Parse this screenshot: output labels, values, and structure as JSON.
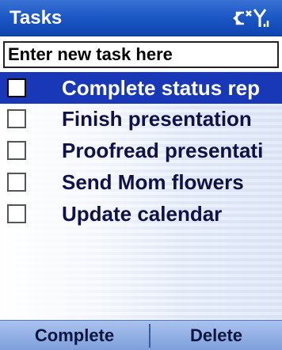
{
  "titlebar": {
    "title": "Tasks",
    "icons": [
      "connectivity-icon",
      "signal-strength-icon"
    ]
  },
  "new_task": {
    "placeholder": "Enter new task here"
  },
  "tasks": [
    {
      "label": "Complete status rep",
      "checked": false,
      "selected": true
    },
    {
      "label": "Finish presentation",
      "checked": false,
      "selected": false
    },
    {
      "label": "Proofread presentati",
      "checked": false,
      "selected": false
    },
    {
      "label": "Send Mom flowers",
      "checked": false,
      "selected": false
    },
    {
      "label": "Update calendar",
      "checked": false,
      "selected": false
    }
  ],
  "softkeys": {
    "left": "Complete",
    "right": "Delete"
  },
  "colors": {
    "titlebar": "#1a56c4",
    "selection": "#1838b8",
    "softkey_bar": "#8fb0e6"
  }
}
